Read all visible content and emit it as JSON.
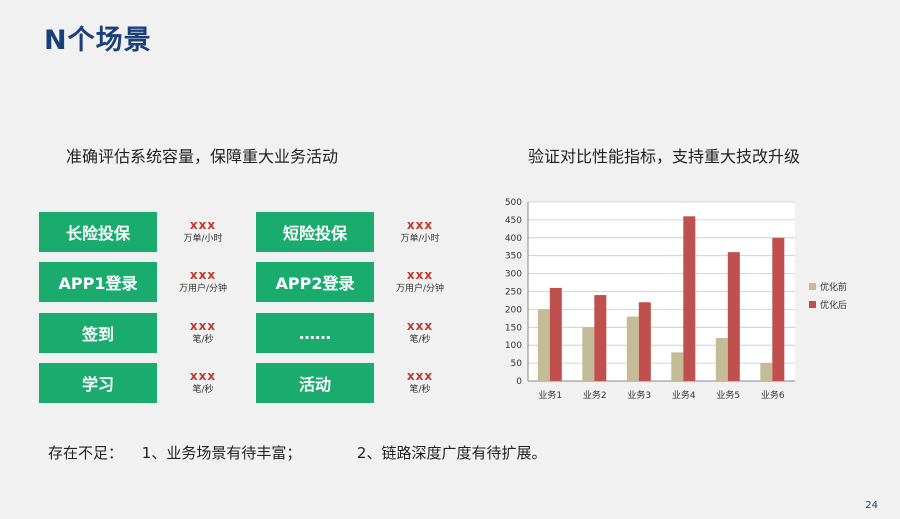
{
  "header": {
    "title": "N个场景"
  },
  "left": {
    "subhead": "准确评估系统容量，保障重大业务活动",
    "scenarios": [
      {
        "label": "长险投保",
        "value": "xxx",
        "unit": "万单/小时"
      },
      {
        "label": "短险投保",
        "value": "xxx",
        "unit": "万单/小时"
      },
      {
        "label": "APP1登录",
        "value": "xxx",
        "unit": "万用户/分钟"
      },
      {
        "label": "APP2登录",
        "value": "xxx",
        "unit": "万用户/分钟"
      },
      {
        "label": "签到",
        "value": "xxx",
        "unit": "笔/秒"
      },
      {
        "label": "……",
        "value": "xxx",
        "unit": "笔/秒"
      },
      {
        "label": "学习",
        "value": "xxx",
        "unit": "笔/秒"
      },
      {
        "label": "活动",
        "value": "xxx",
        "unit": "笔/秒"
      }
    ]
  },
  "right": {
    "subhead": "验证对比性能指标，支持重大技改升级"
  },
  "summary": {
    "prefix": "存在不足：",
    "item1": "1、业务场景有待丰富；",
    "item2": "2、链路深度广度有待扩展。"
  },
  "page_number": "24",
  "colors": {
    "button": "#1aac6e",
    "series_before": "#c4bc96",
    "series_after": "#c0504d",
    "title": "#1b3f7a"
  },
  "chart_data": {
    "type": "bar",
    "categories": [
      "业务1",
      "业务2",
      "业务3",
      "业务4",
      "业务5",
      "业务6"
    ],
    "series": [
      {
        "name": "优化前",
        "values": [
          200,
          150,
          180,
          80,
          120,
          50
        ]
      },
      {
        "name": "优化后",
        "values": [
          260,
          240,
          220,
          460,
          360,
          400
        ]
      }
    ],
    "ylim": [
      0,
      500
    ],
    "yticks": [
      0,
      50,
      100,
      150,
      200,
      250,
      300,
      350,
      400,
      450,
      500
    ],
    "grid": true,
    "legend": "right"
  }
}
